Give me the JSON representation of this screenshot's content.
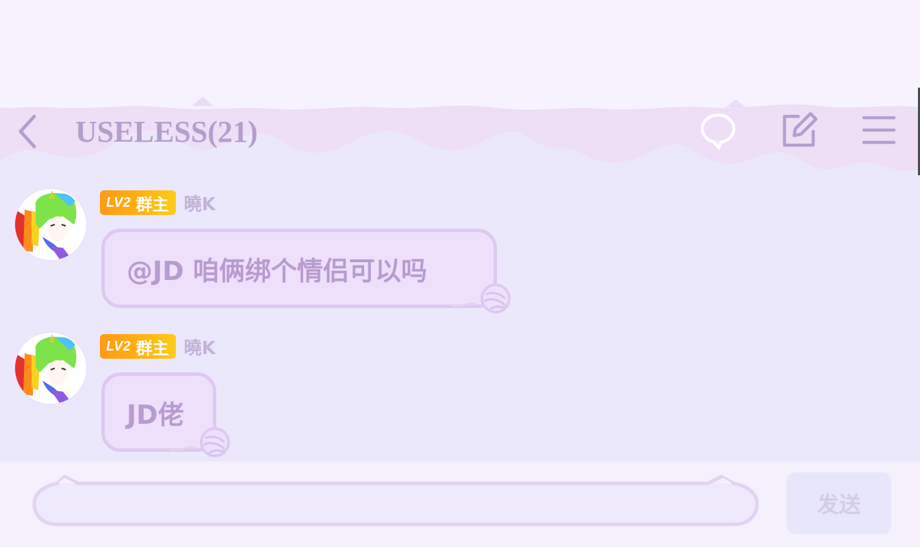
{
  "header": {
    "title": "USELESS(21)",
    "back_icon": "chevron-left-icon",
    "actions": [
      {
        "icon": "chat-bubble-icon"
      },
      {
        "icon": "edit-icon"
      },
      {
        "icon": "menu-icon"
      }
    ]
  },
  "messages": [
    {
      "badge_level": "LV2",
      "badge_role": "群主",
      "sender": "曉K",
      "text": "@JD 咱俩绑个情侣可以吗"
    },
    {
      "badge_level": "LV2",
      "badge_role": "群主",
      "sender": "曉K",
      "text": "JD佬"
    }
  ],
  "composer": {
    "input_value": "",
    "send_label": "发送"
  },
  "colors": {
    "background": "#ece8fb",
    "accent_purple": "#b49fcc",
    "badge_orange": "#ffa414",
    "bubble_fill": "#eedffb",
    "bubble_border": "#ddc9ef"
  }
}
